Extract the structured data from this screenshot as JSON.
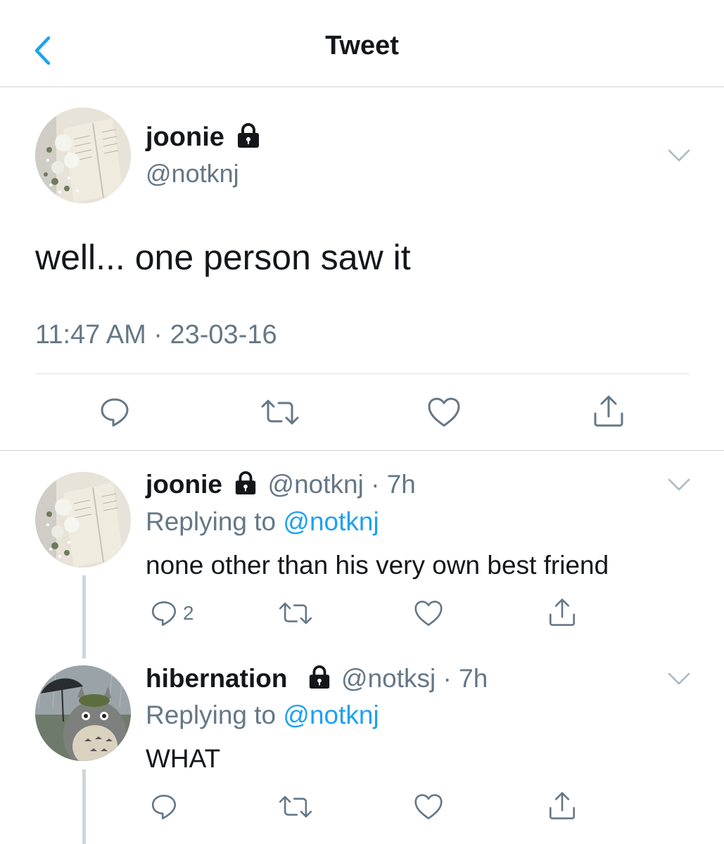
{
  "header": {
    "title": "Tweet",
    "back_icon": "chevron-left-icon"
  },
  "colors": {
    "link": "#1da1f2",
    "secondary": "#657786",
    "divider": "#d0d4d8",
    "text": "#14171a"
  },
  "tweet": {
    "name": "joonie",
    "handle": "@notknj",
    "text": "well... one person saw it",
    "timestamp": "11:47 AM · 23-03-16",
    "locked": true
  },
  "replies": [
    {
      "name": "joonie",
      "handle": "@notknj",
      "time": "· 7h",
      "replying_prefix": "Replying to",
      "replying_to": "@notknj",
      "text": "none other than his very own best friend",
      "reply_count": "2",
      "locked": true
    },
    {
      "name": "hibernation",
      "handle": "@notksj",
      "time": "· 7h",
      "replying_prefix": "Replying to",
      "replying_to": "@notknj",
      "text": "WHAT",
      "reply_count": "",
      "locked": true
    }
  ]
}
